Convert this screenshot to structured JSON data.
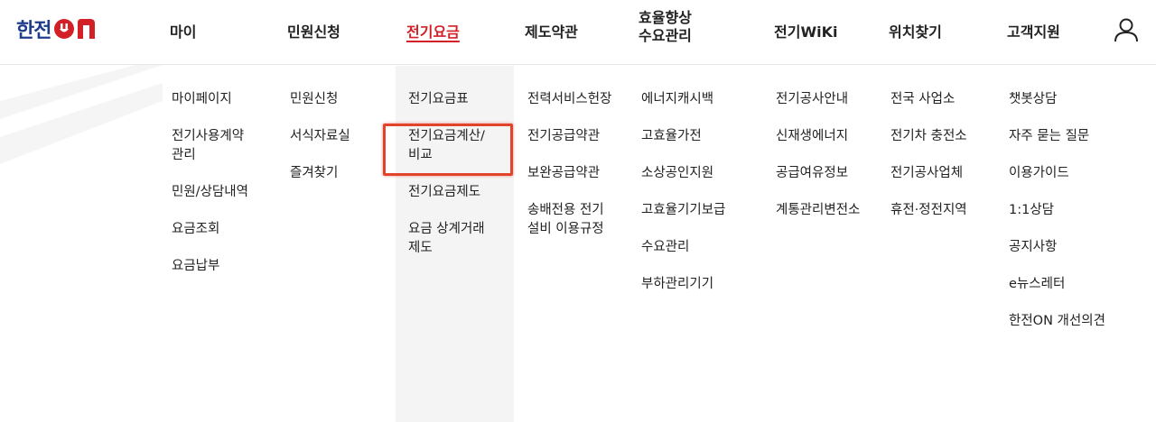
{
  "brand": {
    "name_kr": "한전",
    "name_on": "ON",
    "color_primary": "#1e3c8c",
    "color_accent": "#d31f26"
  },
  "gnb": [
    {
      "label": "마이"
    },
    {
      "label": "민원신청"
    },
    {
      "label": "전기요금",
      "active": true
    },
    {
      "label": "제도약관"
    },
    {
      "label": "효율향상\n수요관리"
    },
    {
      "label": "전기WiKi"
    },
    {
      "label": "위치찾기"
    },
    {
      "label": "고객지원"
    }
  ],
  "user_icon": "user-icon",
  "submenu": [
    {
      "items": [
        "마이페이지",
        "전기사용계약\n관리",
        "민원/상담내역",
        "요금조회",
        "요금납부"
      ]
    },
    {
      "items": [
        "민원신청",
        "서식자료실",
        "즐겨찾기"
      ]
    },
    {
      "items": [
        "전기요금표",
        "전기요금계산/\n비교",
        "전기요금제도",
        "요금 상계거래\n제도"
      ]
    },
    {
      "items": [
        "전력서비스헌장",
        "전기공급약관",
        "보완공급약관",
        "송배전용 전기\n설비 이용규정"
      ]
    },
    {
      "items": [
        "에너지캐시백",
        "고효율가전",
        "소상공인지원",
        "고효율기기보급",
        "수요관리",
        "부하관리기기"
      ]
    },
    {
      "items": [
        "전기공사안내",
        "신재생에너지",
        "공급여유정보",
        "계통관리변전소"
      ]
    },
    {
      "items": [
        "전국 사업소",
        "전기차 충전소",
        "전기공사업체",
        "휴전·정전지역"
      ]
    },
    {
      "items": [
        "챗봇상담",
        "자주 묻는 질문",
        "이용가이드",
        "1:1상담",
        "공지사항",
        "e뉴스레터",
        "한전ON 개선의견"
      ]
    }
  ],
  "highlight_color": "#e2442b"
}
